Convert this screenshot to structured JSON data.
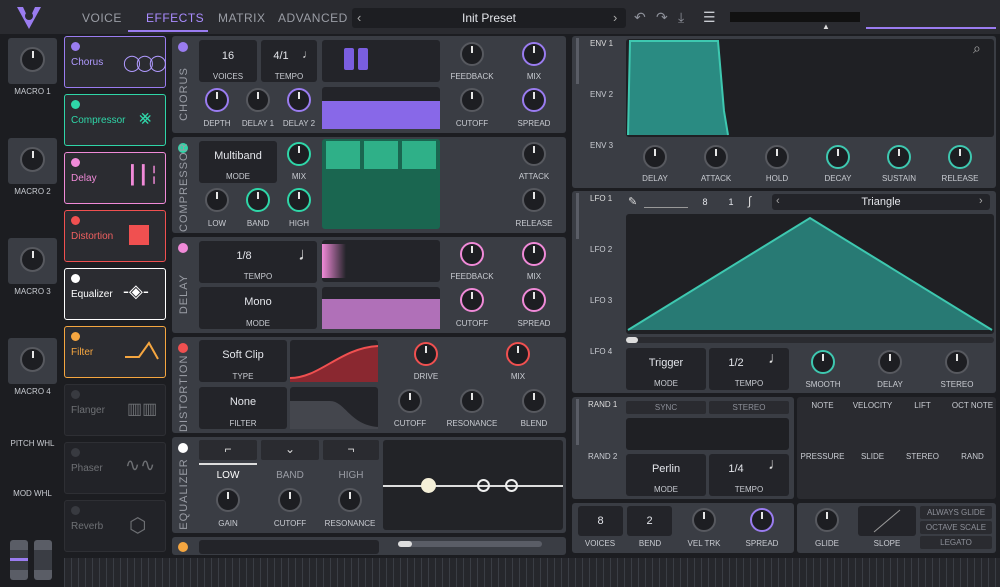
{
  "tabs": [
    "VOICE",
    "EFFECTS",
    "MATRIX",
    "ADVANCED"
  ],
  "preset": "Init Preset",
  "colors": {
    "chorus": "#9a7cf0",
    "compressor": "#2fd6a8",
    "delay": "#f08ad8",
    "distortion": "#f05050",
    "equalizer": "#ffffff",
    "filter": "#f5a640",
    "teal": "#3ec8b0"
  },
  "macros": [
    "MACRO 1",
    "MACRO 2",
    "MACRO 3",
    "MACRO 4"
  ],
  "wheels": {
    "pitch": "PITCH WHL",
    "mod": "MOD WHL"
  },
  "effects": [
    "Chorus",
    "Compressor",
    "Delay",
    "Distortion",
    "Equalizer",
    "Filter",
    "Flanger",
    "Phaser",
    "Reverb"
  ],
  "chorus": {
    "side": "CHORUS",
    "voices": "16",
    "voices_lbl": "VOICES",
    "tempo": "4/1",
    "tempo_lbl": "TEMPO",
    "feedback": "FEEDBACK",
    "mix": "MIX",
    "depth": "DEPTH",
    "delay1": "DELAY 1",
    "delay2": "DELAY 2",
    "cutoff": "CUTOFF",
    "spread": "SPREAD"
  },
  "comp": {
    "side": "COMPRESSOR",
    "mode": "Multiband",
    "mode_lbl": "MODE",
    "mix": "MIX",
    "attack": "ATTACK",
    "low": "LOW",
    "band": "BAND",
    "high": "HIGH",
    "release": "RELEASE"
  },
  "delay": {
    "side": "DELAY",
    "tempo": "1/8",
    "tempo_lbl": "TEMPO",
    "feedback": "FEEDBACK",
    "mix": "MIX",
    "mode": "Mono",
    "mode_lbl": "MODE",
    "cutoff": "CUTOFF",
    "spread": "SPREAD"
  },
  "dist": {
    "side": "DISTORTION",
    "type": "Soft Clip",
    "type_lbl": "TYPE",
    "drive": "DRIVE",
    "mix": "MIX",
    "filter": "None",
    "filter_lbl": "FILTER",
    "cutoff": "CUTOFF",
    "resonance": "RESONANCE",
    "blend": "BLEND"
  },
  "eq": {
    "side": "EQUALIZER",
    "low": "LOW",
    "band": "BAND",
    "high": "HIGH",
    "gain": "GAIN",
    "cutoff": "CUTOFF",
    "resonance": "RESONANCE"
  },
  "env": {
    "tabs": [
      "ENV 1",
      "ENV 2",
      "ENV 3"
    ],
    "knobs": [
      "DELAY",
      "ATTACK",
      "HOLD",
      "DECAY",
      "SUSTAIN",
      "RELEASE"
    ]
  },
  "lfo": {
    "tabs": [
      "LFO 1",
      "LFO 2",
      "LFO 3",
      "LFO 4"
    ],
    "num": "8",
    "den": "1",
    "shape": "Triangle",
    "mode": "Trigger",
    "mode_lbl": "MODE",
    "tempo": "1/2",
    "tempo_lbl": "TEMPO",
    "knobs": [
      "SMOOTH",
      "DELAY",
      "STEREO"
    ]
  },
  "rand": {
    "tabs": [
      "RAND 1",
      "RAND 2"
    ],
    "sync": "SYNC",
    "stereo": "STEREO",
    "mode": "Perlin",
    "mode_lbl": "MODE",
    "tempo": "1/4",
    "tempo_lbl": "TEMPO"
  },
  "mods": [
    "NOTE",
    "VELOCITY",
    "LIFT",
    "OCT NOTE",
    "PRESSURE",
    "SLIDE",
    "STEREO",
    "RAND"
  ],
  "voice": {
    "voices": "8",
    "voices_lbl": "VOICES",
    "bend": "2",
    "bend_lbl": "BEND",
    "veltrk": "VEL TRK",
    "spread": "SPREAD",
    "glide": "GLIDE",
    "slope": "SLOPE",
    "always": "ALWAYS GLIDE",
    "octave": "OCTAVE SCALE",
    "legato": "LEGATO"
  }
}
